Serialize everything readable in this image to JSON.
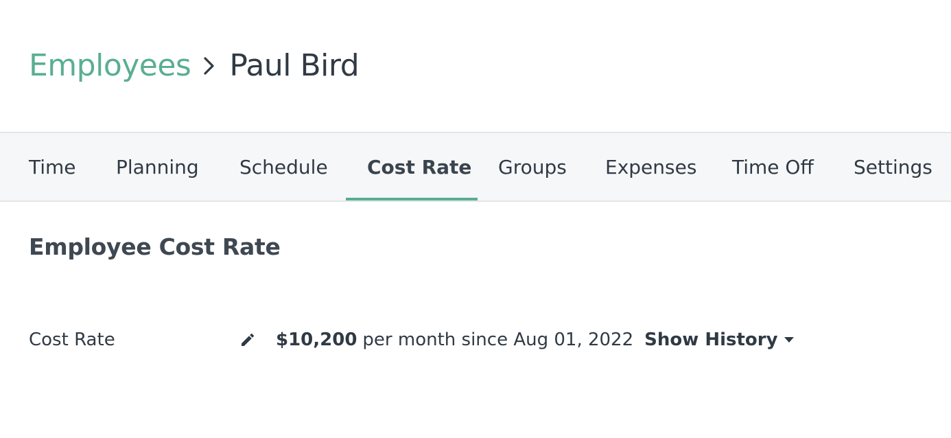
{
  "breadcrumb": {
    "parent": "Employees",
    "current": "Paul Bird"
  },
  "tabs": [
    {
      "label": "Time"
    },
    {
      "label": "Planning"
    },
    {
      "label": "Schedule"
    },
    {
      "label": "Cost Rate",
      "active": true
    },
    {
      "label": "Groups"
    },
    {
      "label": "Expenses"
    },
    {
      "label": "Time Off"
    },
    {
      "label": "Settings"
    }
  ],
  "section": {
    "title": "Employee Cost Rate"
  },
  "cost_rate": {
    "label": "Cost Rate",
    "amount": "$10,200",
    "description": "per month since Aug 01, 2022",
    "show_history": "Show History"
  },
  "colors": {
    "accent": "#5aae92",
    "text": "#303a44",
    "tabbar_bg": "#f6f7f8"
  },
  "icons": {
    "breadcrumb_separator": "chevron-right-icon",
    "edit": "pencil-icon",
    "dropdown": "caret-down-icon"
  }
}
